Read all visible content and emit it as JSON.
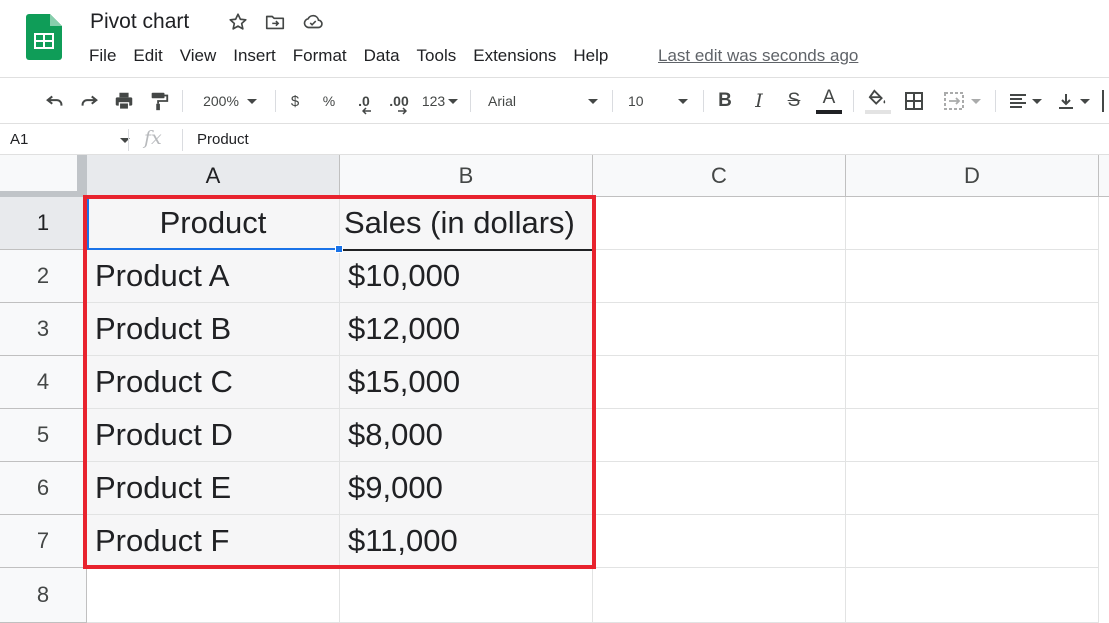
{
  "header": {
    "title": "Pivot chart",
    "menu": [
      "File",
      "Edit",
      "View",
      "Insert",
      "Format",
      "Data",
      "Tools",
      "Extensions",
      "Help"
    ],
    "last_edit": "Last edit was seconds ago"
  },
  "toolbar": {
    "zoom": "200%",
    "currency": "$",
    "percent": "%",
    "decrease_decimal": ".0",
    "increase_decimal": ".00",
    "more_formats": "123",
    "font": "Arial",
    "font_size": "10",
    "bold": "B",
    "italic": "I",
    "strikethrough": "S",
    "text_color": "A"
  },
  "formula_bar": {
    "cell_ref": "A1",
    "fx": "fx",
    "value": "Product"
  },
  "grid": {
    "columns": [
      "A",
      "B",
      "C",
      "D"
    ],
    "rows": [
      "1",
      "2",
      "3",
      "4",
      "5",
      "6",
      "7",
      "8"
    ],
    "selected_cell": "A1",
    "highlight_color": "#e8232e",
    "cells": [
      [
        "Product",
        "Sales (in dollars)"
      ],
      [
        "Product A",
        "$10,000"
      ],
      [
        "Product B",
        "$12,000"
      ],
      [
        "Product C",
        "$15,000"
      ],
      [
        "Product D",
        "$8,000"
      ],
      [
        "Product E",
        "$9,000"
      ],
      [
        "Product F",
        "$11,000"
      ],
      [
        "",
        ""
      ]
    ]
  },
  "colors": {
    "brand_green": "#0f9d58",
    "selection_blue": "#1a73e8",
    "annotation_red": "#e8232e"
  }
}
